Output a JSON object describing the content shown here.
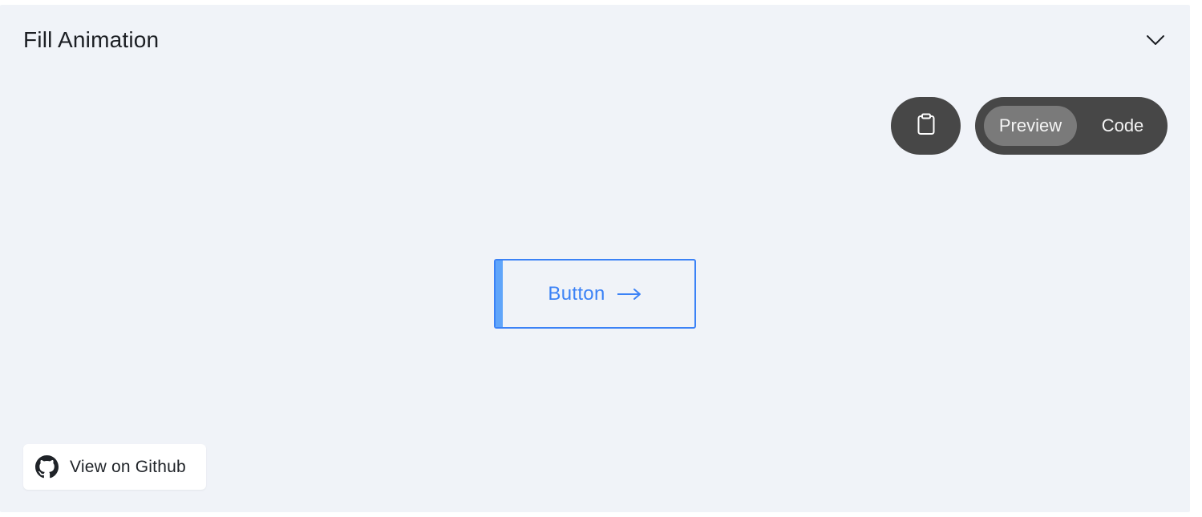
{
  "section": {
    "title": "Fill Animation",
    "collapse_icon": "chevron-down-icon"
  },
  "toolbar": {
    "copy_icon": "clipboard-icon",
    "tabs": [
      {
        "label": "Preview",
        "active": true
      },
      {
        "label": "Code",
        "active": false
      }
    ]
  },
  "demo": {
    "button_label": "Button",
    "arrow_icon": "arrow-right-icon",
    "accent_color": "#3b82f6",
    "fill_color": "#60a5fa"
  },
  "footer": {
    "github_label": "View on Github",
    "github_icon": "github-icon"
  },
  "colors": {
    "panel_background": "#f0f3f8",
    "toolbar_background": "#474747",
    "active_tab_background": "#7a7a7a"
  }
}
